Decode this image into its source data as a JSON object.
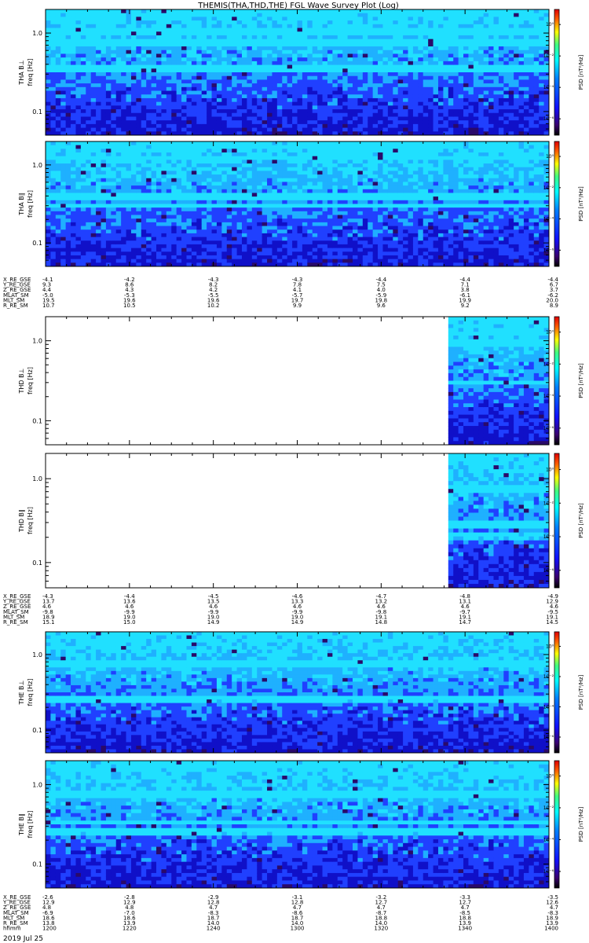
{
  "title": "THEMIS(THA,THD,THE) FGL Wave Survey Plot (Log)",
  "date_label": "2019 Jul 25",
  "colorbar_label": "PSD [nT²/Hz]",
  "colorbar_ticks": [
    "10⁰",
    "10⁻²",
    "10⁻⁴",
    "10⁻⁶"
  ],
  "ylabel_freq": "freq [Hz]",
  "ytick_labels": [
    "1.0",
    "0.1"
  ],
  "chart_data": [
    {
      "type": "heatmap",
      "name": "THA B⊥",
      "ylabel": "THA B⊥",
      "colorscale": [
        "#2a0a6a",
        "#1010c8",
        "#2040ff",
        "#1fb0ff",
        "#20e0ff"
      ],
      "data_start_fraction": 0.0,
      "bright_bands": [
        0.16,
        0.26,
        0.45
      ],
      "seed": 11
    },
    {
      "type": "heatmap",
      "name": "THA B∥",
      "ylabel": "THA B∥",
      "colorscale": [
        "#2a0a6a",
        "#1010c8",
        "#2040ff",
        "#1fb0ff",
        "#20e0ff"
      ],
      "data_start_fraction": 0.0,
      "bright_bands": [
        0.12,
        0.42,
        0.5
      ],
      "seed": 23
    },
    {
      "type": "heatmap",
      "name": "THD B⊥",
      "ylabel": "THD B⊥",
      "colorscale": [
        "#2a0a6a",
        "#1010c8",
        "#2040ff",
        "#1fb0ff",
        "#20e0ff"
      ],
      "data_start_fraction": 0.795,
      "bright_bands": [
        0.12,
        0.2,
        0.5
      ],
      "seed": 37
    },
    {
      "type": "heatmap",
      "name": "THD B∥",
      "ylabel": "THD B∥",
      "colorscale": [
        "#2a0a6a",
        "#1010c8",
        "#2040ff",
        "#1fb0ff",
        "#20e0ff"
      ],
      "data_start_fraction": 0.795,
      "bright_bands": [
        0.25,
        0.52,
        0.6
      ],
      "seed": 41
    },
    {
      "type": "heatmap",
      "name": "THE B⊥",
      "ylabel": "THE B⊥",
      "colorscale": [
        "#2a0a6a",
        "#1010c8",
        "#2040ff",
        "#1fb0ff",
        "#20e0ff"
      ],
      "data_start_fraction": 0.0,
      "bright_bands": [
        0.25,
        0.55
      ],
      "seed": 53
    },
    {
      "type": "heatmap",
      "name": "THE B∥",
      "ylabel": "THE B∥",
      "colorscale": [
        "#2a0a6a",
        "#1010c8",
        "#2040ff",
        "#1fb0ff",
        "#20e0ff"
      ],
      "data_start_fraction": 0.0,
      "bright_bands": [
        0.25,
        0.47,
        0.55
      ],
      "seed": 67
    }
  ],
  "ephemeris": [
    {
      "labels": [
        "X_RE_GSE",
        "Y_RE_GSE",
        "Z_RE_GSE",
        "MLAT_SM",
        "MLT_SM",
        "R_RE_SM"
      ],
      "rows": [
        [
          "-4.1",
          "-4.2",
          "-4.3",
          "-4.3",
          "-4.4",
          "-4.4",
          "-4.4"
        ],
        [
          "9.3",
          "8.6",
          "8.2",
          "7.8",
          "7.5",
          "7.1",
          "6.7"
        ],
        [
          "4.4",
          "4.3",
          "4.2",
          "4.1",
          "4.0",
          "3.8",
          "3.7"
        ],
        [
          "-5.0",
          "-5.3",
          "-5.5",
          "-5.7",
          "-5.9",
          "-6.1",
          "-6.2"
        ],
        [
          "19.5",
          "19.6",
          "19.6",
          "19.7",
          "19.8",
          "19.9",
          "20.0"
        ],
        [
          "10.7",
          "10.5",
          "10.2",
          "9.9",
          "9.6",
          "9.2",
          "8.9"
        ]
      ]
    },
    {
      "labels": [
        "X_RE_GSE",
        "Y_RE_GSE",
        "Z_RE_GSE",
        "MLAT_SM",
        "MLT_SM",
        "R_RE_SM"
      ],
      "rows": [
        [
          "-4.3",
          "-4.4",
          "-4.5",
          "-4.6",
          "-4.7",
          "-4.8",
          "-4.9"
        ],
        [
          "13.7",
          "13.6",
          "13.5",
          "13.3",
          "13.2",
          "13.1",
          "12.9"
        ],
        [
          "4.6",
          "4.6",
          "4.6",
          "4.6",
          "4.6",
          "4.6",
          "4.6"
        ],
        [
          "-9.8",
          "-9.9",
          "-9.9",
          "-9.9",
          "-9.8",
          "-9.7",
          "-9.5"
        ],
        [
          "18.9",
          "19.0",
          "19.0",
          "19.0",
          "19.1",
          "19.1",
          "19.1"
        ],
        [
          "15.1",
          "15.0",
          "14.9",
          "14.9",
          "14.8",
          "14.7",
          "14.5"
        ]
      ]
    },
    {
      "labels": [
        "X_RE_GSE",
        "Y_RE_GSE",
        "Z_RE_GSE",
        "MLAT_SM",
        "MLT_SM",
        "R_RE_SM",
        "hhmm"
      ],
      "rows": [
        [
          "-2.6",
          "-2.8",
          "-2.9",
          "-3.1",
          "-3.2",
          "-3.3",
          "-3.5"
        ],
        [
          "12.9",
          "12.9",
          "12.8",
          "12.8",
          "12.7",
          "12.7",
          "12.6"
        ],
        [
          "4.8",
          "4.8",
          "4.7",
          "4.7",
          "4.7",
          "4.7",
          "4.7"
        ],
        [
          "-6.9",
          "-7.0",
          "-8.3",
          "-8.6",
          "-8.7",
          "-8.5",
          "-8.3"
        ],
        [
          "18.6",
          "18.6",
          "18.7",
          "18.7",
          "18.8",
          "18.8",
          "18.9"
        ],
        [
          "13.8",
          "13.9",
          "14.0",
          "14.0",
          "14.0",
          "13.9",
          "13.9"
        ],
        [
          "1200",
          "1220",
          "1240",
          "1300",
          "1320",
          "1340",
          "1400"
        ]
      ]
    }
  ]
}
